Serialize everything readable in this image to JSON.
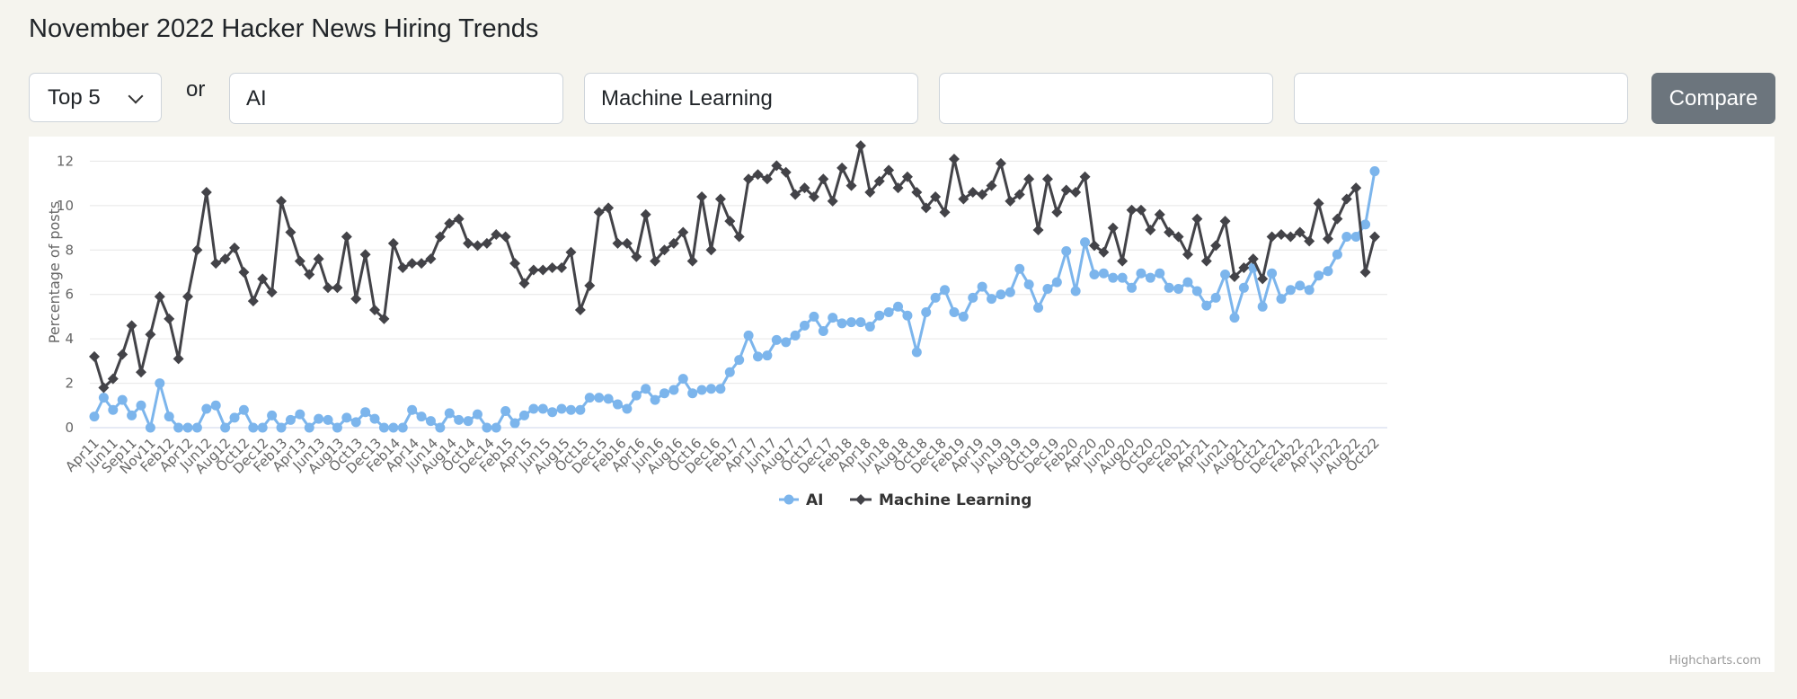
{
  "page": {
    "title": "November 2022 Hacker News Hiring Trends"
  },
  "controls": {
    "select_value": "Top 5",
    "or_label": "or",
    "inputs": [
      "AI",
      "Machine Learning",
      "",
      ""
    ],
    "compare_label": "Compare"
  },
  "credits": "Highcharts.com",
  "colors": {
    "ai": "#7cb5ec",
    "ml": "#434348",
    "compare_button": "#6c757d",
    "background": "#f5f4ee"
  },
  "chart_data": {
    "type": "line",
    "title": "",
    "xlabel": "",
    "ylabel": "Percentage of posts",
    "ylim": [
      0,
      14
    ],
    "yticks": [
      0,
      2,
      4,
      6,
      8,
      10,
      12,
      14
    ],
    "grid": true,
    "legend_position": "bottom-center",
    "x_tick_labels": [
      "Apr11",
      "Jun11",
      "Sep11",
      "Nov11",
      "Feb12",
      "Apr12",
      "Jun12",
      "Aug12",
      "Oct12",
      "Dec12",
      "Feb13",
      "Apr13",
      "Jun13",
      "Aug13",
      "Oct13",
      "Dec13",
      "Feb14",
      "Apr14",
      "Jun14",
      "Aug14",
      "Oct14",
      "Dec14",
      "Feb15",
      "Apr15",
      "Jun15",
      "Aug15",
      "Oct15",
      "Dec15",
      "Feb16",
      "Apr16",
      "Jun16",
      "Aug16",
      "Oct16",
      "Dec16",
      "Feb17",
      "Apr17",
      "Jun17",
      "Aug17",
      "Oct17",
      "Dec17",
      "Feb18",
      "Apr18",
      "Jun18",
      "Aug18",
      "Oct18",
      "Dec18",
      "Feb19",
      "Apr19",
      "Jun19",
      "Aug19",
      "Oct19",
      "Dec19",
      "Feb20",
      "Apr20",
      "Jun20",
      "Aug20",
      "Oct20",
      "Dec20",
      "Feb21",
      "Apr21",
      "Jun21",
      "Aug21",
      "Oct21",
      "Dec21",
      "Feb22",
      "Apr22",
      "Jun22",
      "Aug22",
      "Oct22"
    ],
    "series": [
      {
        "name": "AI",
        "marker": "circle",
        "values": [
          0.5,
          1.35,
          0.8,
          1.25,
          0.55,
          1.0,
          0.0,
          2.0,
          0.5,
          0.0,
          0.0,
          0.0,
          0.85,
          1.0,
          0.0,
          0.45,
          0.8,
          0.0,
          0.0,
          0.55,
          0.0,
          0.35,
          0.6,
          0.0,
          0.4,
          0.35,
          0.0,
          0.45,
          0.25,
          0.7,
          0.4,
          0.0,
          0.0,
          0.0,
          0.8,
          0.5,
          0.3,
          0.0,
          0.65,
          0.35,
          0.3,
          0.6,
          0.0,
          0.0,
          0.75,
          0.2,
          0.55,
          0.85,
          0.85,
          0.7,
          0.85,
          0.8,
          0.8,
          1.35,
          1.35,
          1.3,
          1.05,
          0.85,
          1.45,
          1.75,
          1.25,
          1.55,
          1.7,
          2.2,
          1.55,
          1.7,
          1.75,
          1.75,
          2.5,
          3.05,
          4.15,
          3.2,
          3.25,
          3.95,
          3.85,
          4.15,
          4.6,
          5.0,
          4.35,
          4.95,
          4.7,
          4.75,
          4.75,
          4.55,
          5.05,
          5.2,
          5.45,
          5.05,
          3.4,
          5.2,
          5.85,
          6.2,
          5.2,
          5.0,
          5.85,
          6.35,
          5.8,
          6.0,
          6.1,
          7.15,
          6.45,
          5.4,
          6.25,
          6.55,
          7.95,
          6.15,
          8.35,
          6.9,
          6.95,
          6.75,
          6.75,
          6.3,
          6.95,
          6.75,
          6.95,
          6.3,
          6.25,
          6.55,
          6.15,
          5.5,
          5.85,
          6.9,
          4.95,
          6.3,
          7.2,
          5.45,
          6.95,
          5.8,
          6.2,
          6.4,
          6.2,
          6.85,
          7.05,
          7.8,
          8.6,
          8.6,
          9.15,
          11.55
        ]
      },
      {
        "name": "Machine Learning",
        "marker": "diamond",
        "values": [
          3.2,
          1.8,
          2.2,
          3.3,
          4.6,
          2.5,
          4.2,
          5.9,
          4.9,
          3.1,
          5.9,
          8.0,
          10.6,
          7.4,
          7.6,
          8.1,
          7.0,
          5.7,
          6.7,
          6.1,
          10.2,
          8.8,
          7.5,
          6.9,
          7.6,
          6.3,
          6.3,
          8.6,
          5.8,
          7.8,
          5.3,
          4.9,
          8.3,
          7.2,
          7.4,
          7.4,
          7.6,
          8.6,
          9.2,
          9.4,
          8.3,
          8.2,
          8.3,
          8.7,
          8.6,
          7.4,
          6.5,
          7.1,
          7.1,
          7.2,
          7.2,
          7.9,
          5.3,
          6.4,
          9.7,
          9.9,
          8.3,
          8.3,
          7.7,
          9.6,
          7.5,
          8.0,
          8.3,
          8.8,
          7.5,
          10.4,
          8.0,
          10.3,
          9.3,
          8.6,
          11.2,
          11.4,
          11.2,
          11.8,
          11.5,
          10.5,
          10.8,
          10.4,
          11.2,
          10.2,
          11.7,
          10.9,
          12.7,
          10.6,
          11.1,
          11.6,
          10.8,
          11.3,
          10.6,
          9.9,
          10.4,
          9.7,
          12.1,
          10.3,
          10.6,
          10.5,
          10.9,
          11.9,
          10.2,
          10.5,
          11.2,
          8.9,
          11.2,
          9.7,
          10.7,
          10.6,
          11.3,
          8.2,
          7.9,
          9.0,
          7.5,
          9.8,
          9.8,
          8.9,
          9.6,
          8.8,
          8.6,
          7.8,
          9.4,
          7.5,
          8.2,
          9.3,
          6.8,
          7.2,
          7.6,
          6.7,
          8.6,
          8.7,
          8.6,
          8.8,
          8.4,
          10.1,
          8.5,
          9.4,
          10.3,
          10.8,
          7.0,
          8.6
        ]
      }
    ]
  }
}
